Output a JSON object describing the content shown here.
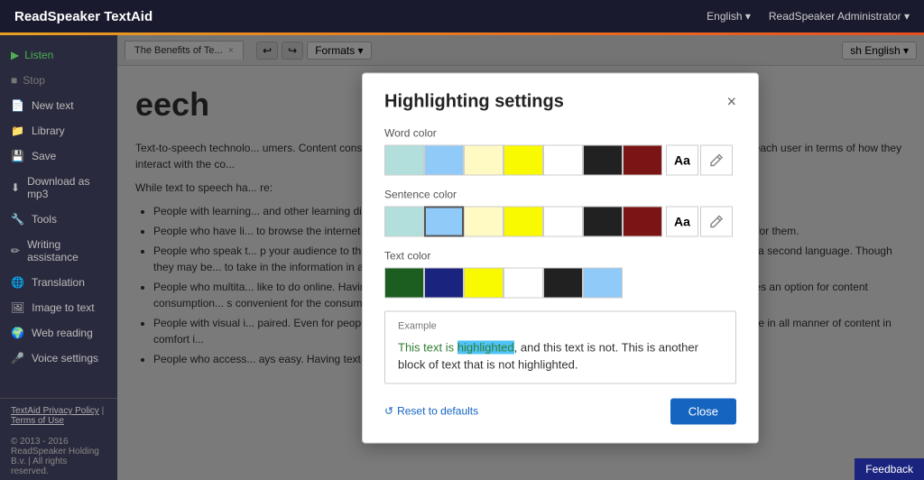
{
  "app": {
    "title": "ReadSpeaker TextAid",
    "accent_bar_color": "#e8a020",
    "language_selector": "English",
    "user_selector": "ReadSpeaker Administrator"
  },
  "sidebar": {
    "items": [
      {
        "id": "listen",
        "label": "Listen",
        "icon": "▶",
        "active": true
      },
      {
        "id": "stop",
        "label": "Stop",
        "icon": "■",
        "disabled": true
      },
      {
        "id": "new-text",
        "label": "New text",
        "icon": "📄"
      },
      {
        "id": "library",
        "label": "Library",
        "icon": "📁"
      },
      {
        "id": "save",
        "label": "Save",
        "icon": "💾"
      },
      {
        "id": "download",
        "label": "Download as mp3",
        "icon": "⬇"
      },
      {
        "id": "tools",
        "label": "Tools",
        "icon": "🔧"
      },
      {
        "id": "writing",
        "label": "Writing assistance",
        "icon": "✏"
      },
      {
        "id": "translation",
        "label": "Translation",
        "icon": "🌐"
      },
      {
        "id": "image-to-text",
        "label": "Image to text",
        "icon": "🖼"
      },
      {
        "id": "web-reading",
        "label": "Web reading",
        "icon": "🌍"
      },
      {
        "id": "voice-settings",
        "label": "Voice settings",
        "icon": "🎤"
      }
    ],
    "footer_links": [
      {
        "label": "TextAid Privacy Policy"
      },
      {
        "label": "Terms of Use"
      }
    ],
    "copyright": "© 2013 - 2016 ReadSpeaker Holding B.v. | All rights reserved."
  },
  "content": {
    "tab_title": "The Benefits of Te...",
    "toolbar_undo": "↩",
    "toolbar_redo": "↪",
    "formats_label": "Formats ▾",
    "language_btn": "sh English ▾",
    "heading": "eech",
    "paragraphs": [
      "Text-to-speech technolo... umers. Content consumers can be website visitors, mobile application users... nt needs and desires of each user in terms of how they interact with the co...",
      "While text to speech ha... re:"
    ],
    "list_items": [
      "People with learning... and other learning disabilities. Offering them an easier option for exp...",
      "People who have li... to browse the internet because so much of it is in text form. By offering... a way that is more comfortable for them.",
      "People who speak t... p your audience to this under-served population. Many people who co... ay still have difficulty reading in a second language. Though they may be... to take in the information in a way they are more comfortable with, m...",
      "People who multita... like to do online. Having a chance to listen to the content instead of re... hones and tablets, it also provides an option for content consumption... s convenient for the consumer.",
      "People with visual i... paired. Even for people with the visual capability to read, the process ca... with visual impairment can take in all manner of content in comfort i...",
      "People who access... ays easy. Having text-to-speech software doing the"
    ]
  },
  "modal": {
    "title": "Highlighting settings",
    "close_label": "×",
    "word_color_label": "Word color",
    "sentence_color_label": "Sentence color",
    "text_color_label": "Text color",
    "aa_label": "Aa",
    "word_swatches": [
      {
        "color": "#b2dfdb",
        "selected": false
      },
      {
        "color": "#90caf9",
        "selected": false
      },
      {
        "color": "#fff9c4",
        "selected": false
      },
      {
        "color": "#f9f900",
        "selected": false
      },
      {
        "color": "#fff",
        "selected": false
      },
      {
        "color": "#212121",
        "selected": false
      },
      {
        "color": "#7b1515",
        "selected": false
      }
    ],
    "sentence_swatches": [
      {
        "color": "#b2dfdb",
        "selected": false
      },
      {
        "color": "#90caf9",
        "selected": true
      },
      {
        "color": "#fff9c4",
        "selected": false
      },
      {
        "color": "#f9f900",
        "selected": false
      },
      {
        "color": "#fff",
        "selected": false
      },
      {
        "color": "#212121",
        "selected": false
      },
      {
        "color": "#7b1515",
        "selected": false
      }
    ],
    "text_swatches": [
      {
        "color": "#1b5e20",
        "selected": false
      },
      {
        "color": "#1a237e",
        "selected": false
      },
      {
        "color": "#f9f900",
        "selected": false
      },
      {
        "color": "#fff",
        "selected": false
      },
      {
        "color": "#212121",
        "selected": false
      },
      {
        "color": "#90caf9",
        "selected": false
      }
    ],
    "example_label": "Example",
    "example_highlighted_word": "This text is",
    "example_highlight_word": "highlighted",
    "example_rest": ", and this text is not. This is another block of text that is not highlighted.",
    "reset_label": "Reset to defaults",
    "close_btn_label": "Close"
  },
  "feedback": {
    "label": "Feedback"
  }
}
